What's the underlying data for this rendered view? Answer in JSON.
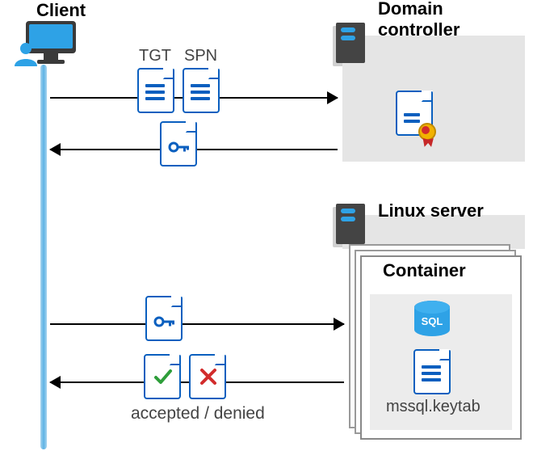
{
  "client": {
    "title": "Client"
  },
  "domain_controller": {
    "title": "Domain\ncontroller"
  },
  "linux_server": {
    "title": "Linux server"
  },
  "container": {
    "title": "Container",
    "keytab_file": "mssql.keytab"
  },
  "flow": {
    "step1": {
      "tgt_label": "TGT",
      "spn_label": "SPN",
      "direction": "client_to_dc",
      "icons": [
        "document-tgt-icon",
        "document-spn-icon"
      ]
    },
    "step2": {
      "direction": "dc_to_client",
      "icons": [
        "document-key-icon"
      ]
    },
    "step3": {
      "direction": "client_to_linux",
      "icons": [
        "document-key-icon"
      ]
    },
    "step4": {
      "direction": "linux_to_client",
      "status_label": "accepted / denied",
      "icons": [
        "document-accepted-icon",
        "document-denied-icon"
      ]
    }
  },
  "icons": {
    "monitor": "monitor-icon",
    "user": "user-icon",
    "server": "server-icon",
    "certificate": "certificate-icon",
    "sql": "sql-azure-icon",
    "key": "key-icon",
    "check": "checkmark-icon",
    "cross": "cross-icon"
  }
}
